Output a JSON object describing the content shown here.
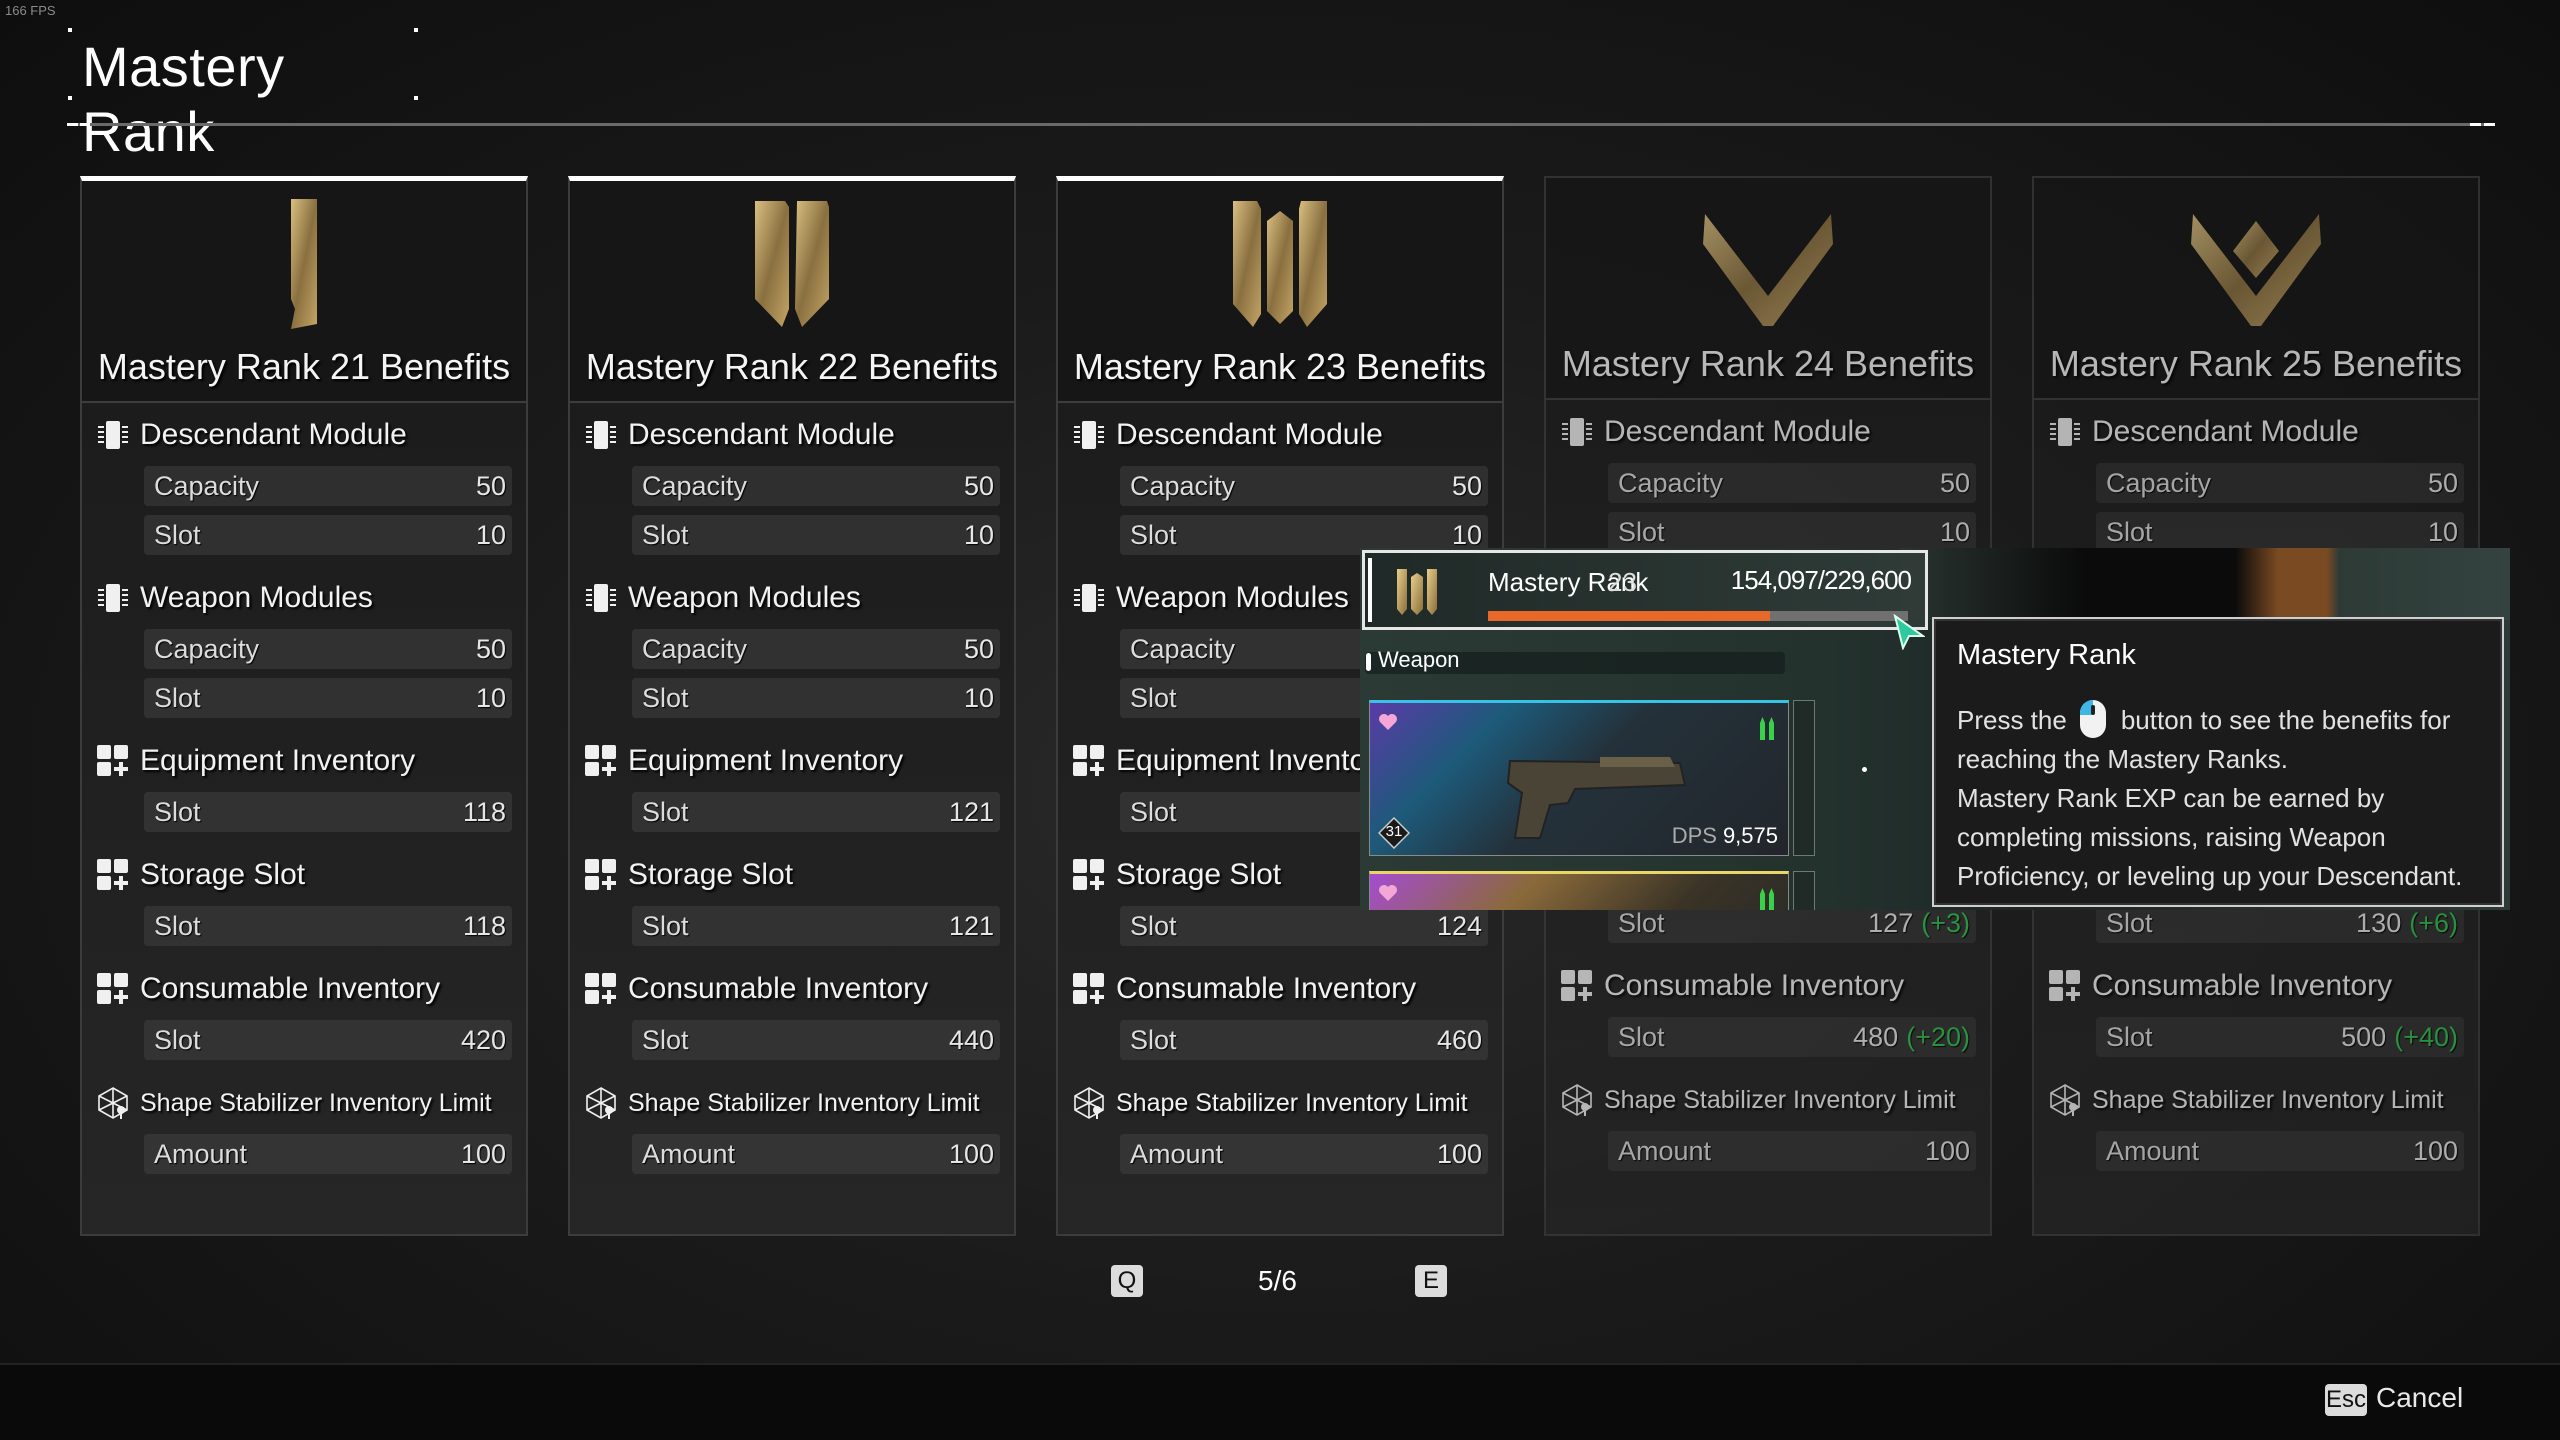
{
  "fps": "166 FPS",
  "header": {
    "title": "Mastery Rank"
  },
  "cards": [
    {
      "title": "Mastery Rank 21 Benefits",
      "rank_icon": "roman-numeral-one-emblem",
      "state": "unlocked",
      "sections": [
        {
          "label": "Descendant Module",
          "icon": "module-chip-icon",
          "rows": [
            {
              "k": "Capacity",
              "v": "50"
            },
            {
              "k": "Slot",
              "v": "10"
            }
          ]
        },
        {
          "label": "Weapon Modules",
          "icon": "module-chip-icon",
          "rows": [
            {
              "k": "Capacity",
              "v": "50"
            },
            {
              "k": "Slot",
              "v": "10"
            }
          ]
        },
        {
          "label": "Equipment Inventory",
          "icon": "inventory-grid-plus-icon",
          "rows": [
            {
              "k": "Slot",
              "v": "118"
            }
          ]
        },
        {
          "label": "Storage Slot",
          "icon": "inventory-grid-plus-icon",
          "rows": [
            {
              "k": "Slot",
              "v": "118"
            }
          ]
        },
        {
          "label": "Consumable Inventory",
          "icon": "inventory-grid-plus-icon",
          "rows": [
            {
              "k": "Slot",
              "v": "420"
            }
          ]
        },
        {
          "label": "Shape Stabilizer Inventory Limit",
          "icon": "shape-stabilizer-icon",
          "rows": [
            {
              "k": "Amount",
              "v": "100"
            }
          ]
        }
      ]
    },
    {
      "title": "Mastery Rank 22 Benefits",
      "rank_icon": "roman-numeral-two-emblem",
      "state": "unlocked",
      "sections": [
        {
          "label": "Descendant Module",
          "icon": "module-chip-icon",
          "rows": [
            {
              "k": "Capacity",
              "v": "50"
            },
            {
              "k": "Slot",
              "v": "10"
            }
          ]
        },
        {
          "label": "Weapon Modules",
          "icon": "module-chip-icon",
          "rows": [
            {
              "k": "Capacity",
              "v": "50"
            },
            {
              "k": "Slot",
              "v": "10"
            }
          ]
        },
        {
          "label": "Equipment Inventory",
          "icon": "inventory-grid-plus-icon",
          "rows": [
            {
              "k": "Slot",
              "v": "121"
            }
          ]
        },
        {
          "label": "Storage Slot",
          "icon": "inventory-grid-plus-icon",
          "rows": [
            {
              "k": "Slot",
              "v": "121"
            }
          ]
        },
        {
          "label": "Consumable Inventory",
          "icon": "inventory-grid-plus-icon",
          "rows": [
            {
              "k": "Slot",
              "v": "440"
            }
          ]
        },
        {
          "label": "Shape Stabilizer Inventory Limit",
          "icon": "shape-stabilizer-icon",
          "rows": [
            {
              "k": "Amount",
              "v": "100"
            }
          ]
        }
      ]
    },
    {
      "title": "Mastery Rank 23 Benefits",
      "rank_icon": "roman-numeral-three-emblem",
      "state": "current",
      "sections": [
        {
          "label": "Descendant Module",
          "icon": "module-chip-icon",
          "rows": [
            {
              "k": "Capacity",
              "v": "50"
            },
            {
              "k": "Slot",
              "v": "10"
            }
          ]
        },
        {
          "label": "Weapon Modules",
          "icon": "module-chip-icon",
          "rows": [
            {
              "k": "Capacity",
              "v": ""
            },
            {
              "k": "Slot",
              "v": ""
            }
          ]
        },
        {
          "label": "Equipment Inventory",
          "icon": "inventory-grid-plus-icon",
          "rows": [
            {
              "k": "Slot",
              "v": ""
            }
          ]
        },
        {
          "label": "Storage Slot",
          "icon": "inventory-grid-plus-icon",
          "rows": [
            {
              "k": "Slot",
              "v": "124"
            }
          ]
        },
        {
          "label": "Consumable Inventory",
          "icon": "inventory-grid-plus-icon",
          "rows": [
            {
              "k": "Slot",
              "v": "460"
            }
          ]
        },
        {
          "label": "Shape Stabilizer Inventory Limit",
          "icon": "shape-stabilizer-icon",
          "rows": [
            {
              "k": "Amount",
              "v": "100"
            }
          ]
        }
      ]
    },
    {
      "title": "Mastery Rank 24 Benefits",
      "rank_icon": "chevron-v-emblem",
      "state": "locked",
      "sections": [
        {
          "label": "Descendant Module",
          "icon": "module-chip-icon",
          "rows": [
            {
              "k": "Capacity",
              "v": "50"
            },
            {
              "k": "Slot",
              "v": "10"
            }
          ]
        },
        {
          "label": "",
          "icon": "",
          "rows": []
        },
        {
          "label": "",
          "icon": "",
          "rows": []
        },
        {
          "label": "",
          "icon": "",
          "rows": [
            {
              "k": "Slot",
              "v": "127",
              "bonus": "(+3)"
            }
          ]
        },
        {
          "label": "Consumable Inventory",
          "icon": "inventory-grid-plus-icon",
          "rows": [
            {
              "k": "Slot",
              "v": "480",
              "bonus": "(+20)"
            }
          ]
        },
        {
          "label": "Shape Stabilizer Inventory Limit",
          "icon": "shape-stabilizer-icon",
          "rows": [
            {
              "k": "Amount",
              "v": "100"
            }
          ]
        }
      ]
    },
    {
      "title": "Mastery Rank 25 Benefits",
      "rank_icon": "chevron-v-diamond-emblem",
      "state": "locked",
      "sections": [
        {
          "label": "Descendant Module",
          "icon": "module-chip-icon",
          "rows": [
            {
              "k": "Capacity",
              "v": "50"
            },
            {
              "k": "Slot",
              "v": "10"
            }
          ]
        },
        {
          "label": "",
          "icon": "",
          "rows": []
        },
        {
          "label": "",
          "icon": "",
          "rows": []
        },
        {
          "label": "",
          "icon": "",
          "rows": [
            {
              "k": "Slot",
              "v": "130",
              "bonus": "(+6)"
            }
          ]
        },
        {
          "label": "Consumable Inventory",
          "icon": "inventory-grid-plus-icon",
          "rows": [
            {
              "k": "Slot",
              "v": "500",
              "bonus": "(+40)"
            }
          ]
        },
        {
          "label": "Shape Stabilizer Inventory Limit",
          "icon": "shape-stabilizer-icon",
          "rows": [
            {
              "k": "Amount",
              "v": "100"
            }
          ]
        }
      ]
    }
  ],
  "pager": {
    "prev_key": "Q",
    "next_key": "E",
    "page": "5/6"
  },
  "footer": {
    "cancel_key": "Esc",
    "cancel_label": "Cancel"
  },
  "overlay": {
    "rank_label": "Mastery Rank",
    "rank_level": "23",
    "exp_text": "154,097/229,600",
    "exp_fraction": 0.671,
    "exp_color": "#e8682a",
    "weapon_section": "Weapon",
    "weapons": [
      {
        "level": "31",
        "dps_label": "DPS",
        "dps": "9,575",
        "rarity_color": "#38c2e6"
      },
      {
        "level": "",
        "dps_label": "",
        "dps": "",
        "rarity_color": "#e8d66a"
      }
    ]
  },
  "tooltip": {
    "title": "Mastery Rank",
    "line1_pre": "Press the",
    "line1_post": "button to see the benefits for reaching the Mastery Ranks.",
    "line2": "Mastery Rank EXP can be earned by completing missions, raising Weapon Proficiency, or leveling up your Descendant.",
    "input_icon": "mouse-button-icon"
  },
  "colors": {
    "bonus_green": "#2fbf4f",
    "gold": "#b89a62"
  }
}
